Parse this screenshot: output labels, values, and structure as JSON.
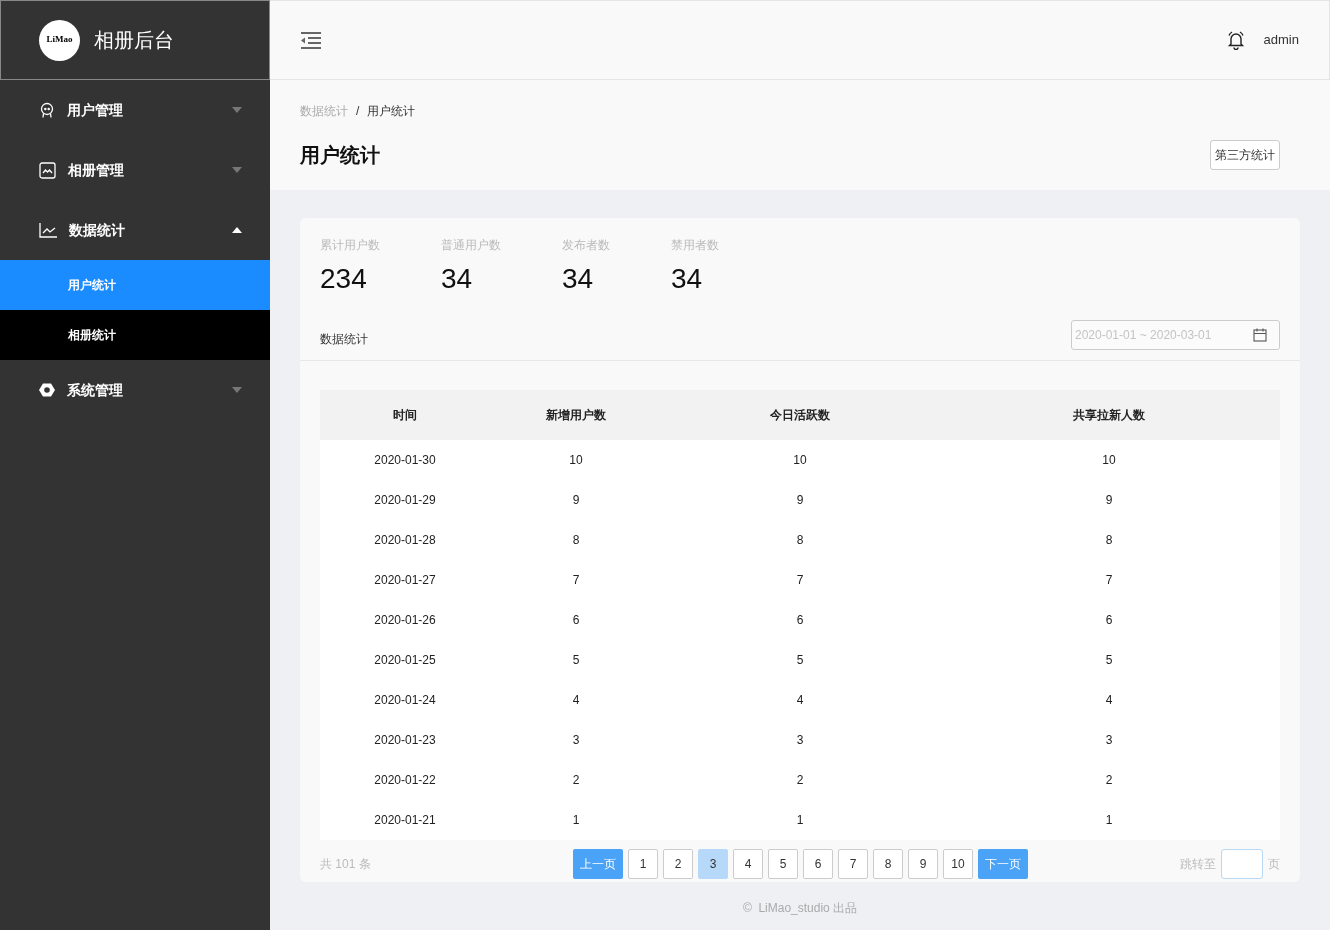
{
  "brand": {
    "logo_text": "LiMao",
    "title": "相册后台"
  },
  "sidebar": {
    "items": [
      {
        "label": "用户管理",
        "expanded": false
      },
      {
        "label": "相册管理",
        "expanded": false
      },
      {
        "label": "数据统计",
        "expanded": true,
        "children": [
          {
            "label": "用户统计",
            "selected": true
          },
          {
            "label": "相册统计",
            "selected": false
          }
        ]
      },
      {
        "label": "系统管理",
        "expanded": false
      }
    ]
  },
  "header": {
    "user": "admin"
  },
  "breadcrumb": {
    "separator": "/",
    "items": [
      {
        "label": "数据统计"
      },
      {
        "label": "用户统计"
      }
    ]
  },
  "page_title": "用户统计",
  "action_button": "第三方统计",
  "stats": [
    {
      "label": "累计用户数",
      "value": "234"
    },
    {
      "label": "普通用户数",
      "value": "34"
    },
    {
      "label": "发布者数",
      "value": "34"
    },
    {
      "label": "禁用者数",
      "value": "34"
    }
  ],
  "section_title": "数据统计",
  "date_range": {
    "placeholder": "2020-01-01 ~ 2020-03-01"
  },
  "table": {
    "columns": [
      "时间",
      "新增用户数",
      "今日活跃数",
      "共享拉新人数"
    ],
    "rows": [
      [
        "2020-01-30",
        "10",
        "10",
        "10"
      ],
      [
        "2020-01-29",
        "9",
        "9",
        "9"
      ],
      [
        "2020-01-28",
        "8",
        "8",
        "8"
      ],
      [
        "2020-01-27",
        "7",
        "7",
        "7"
      ],
      [
        "2020-01-26",
        "6",
        "6",
        "6"
      ],
      [
        "2020-01-25",
        "5",
        "5",
        "5"
      ],
      [
        "2020-01-24",
        "4",
        "4",
        "4"
      ],
      [
        "2020-01-23",
        "3",
        "3",
        "3"
      ],
      [
        "2020-01-22",
        "2",
        "2",
        "2"
      ],
      [
        "2020-01-21",
        "1",
        "1",
        "1"
      ]
    ]
  },
  "pagination": {
    "total": "共 101 条",
    "prev": "上一页",
    "next": "下一页",
    "pages": [
      {
        "label": "1",
        "selected": false
      },
      {
        "label": "2",
        "selected": false
      },
      {
        "label": "3",
        "selected": true
      },
      {
        "label": "4",
        "selected": false
      },
      {
        "label": "5",
        "selected": false
      },
      {
        "label": "6",
        "selected": false
      },
      {
        "label": "7",
        "selected": false
      },
      {
        "label": "8",
        "selected": false
      },
      {
        "label": "9",
        "selected": false
      },
      {
        "label": "10",
        "selected": false
      }
    ],
    "jump_label": "跳转至",
    "jump_suffix": "页"
  },
  "footer": "©  LiMao_studio 出品"
}
